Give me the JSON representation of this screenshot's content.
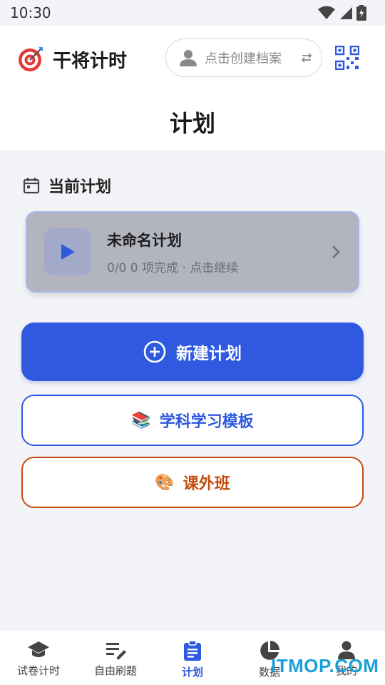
{
  "status_bar": {
    "time": "10:30"
  },
  "header": {
    "app_name": "干将计时",
    "profile_button_label": "点击创建档案",
    "page_title": "计划"
  },
  "current_plan": {
    "section_title": "当前计划",
    "plan_name": "未命名计划",
    "plan_subtitle": "0/0 0 项完成 · 点击继续"
  },
  "actions": {
    "new_plan_label": "新建计划",
    "template_label": "学科学习模板",
    "template_emoji": "📚",
    "class_label": "课外班",
    "class_emoji": "🎨"
  },
  "bottom_nav": {
    "items": [
      {
        "label": "试卷计时",
        "icon": "graduation-cap-icon"
      },
      {
        "label": "自由刷题",
        "icon": "edit-list-icon"
      },
      {
        "label": "计划",
        "icon": "clipboard-icon",
        "active": true
      },
      {
        "label": "数据",
        "icon": "pie-chart-icon"
      },
      {
        "label": "我的",
        "icon": "person-icon"
      }
    ]
  },
  "watermark": "ITMOP.COM",
  "colors": {
    "primary": "#2f5ae0",
    "accent_orange": "#c44d0e",
    "background": "#f3f4f8"
  }
}
